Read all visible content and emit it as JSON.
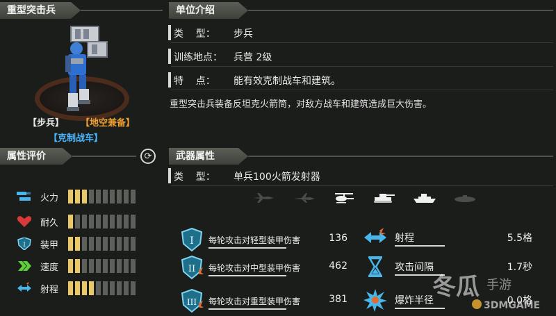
{
  "unit": {
    "name": "重型突击兵",
    "tags": {
      "infantry": "【步兵】",
      "air_ground": "【地空兼备】",
      "counter": "【克制战车】"
    }
  },
  "attributes": {
    "title": "属性评价",
    "items": [
      {
        "label": "火力",
        "icon": "firepower-icon",
        "filled": 3,
        "total": 10
      },
      {
        "label": "耐久",
        "icon": "heart-icon",
        "filled": 1,
        "total": 10
      },
      {
        "label": "装甲",
        "icon": "armor-shield-icon",
        "filled": 2,
        "total": 10
      },
      {
        "label": "速度",
        "icon": "speed-chevrons-icon",
        "filled": 2,
        "total": 10
      },
      {
        "label": "射程",
        "icon": "range-arrows-icon",
        "filled": 4,
        "total": 10
      }
    ]
  },
  "intro": {
    "title": "单位介绍",
    "rows": [
      {
        "key": "类    型：",
        "value": "步兵"
      },
      {
        "key": "训练地点：",
        "value": "兵营 2级"
      },
      {
        "key": "特    点：",
        "value": "能有效克制战车和建筑。"
      }
    ],
    "description": "重型突击兵装备反坦克火箭筒，对敌方战车和建筑造成巨大伤害。"
  },
  "weapon": {
    "title": "武器属性",
    "type_key": "类    型：",
    "type_value": "单兵100火箭发射器",
    "targets": [
      {
        "icon": "jet-fighter-icon",
        "active": false
      },
      {
        "icon": "bomber-plane-icon",
        "active": false
      },
      {
        "icon": "helicopter-icon",
        "active": true
      },
      {
        "icon": "tank-icon",
        "active": true
      },
      {
        "icon": "ship-icon",
        "active": true
      },
      {
        "icon": "submarine-icon",
        "active": false
      }
    ],
    "damage": [
      {
        "label": "每轮攻击对轻型装甲伤害",
        "value": "136",
        "tier": "I"
      },
      {
        "label": "每轮攻击对中型装甲伤害",
        "value": "462",
        "tier": "II"
      },
      {
        "label": "每轮攻击对重型装甲伤害",
        "value": "381",
        "tier": "III"
      }
    ],
    "stats": [
      {
        "label": "射程",
        "value": "5.5格",
        "icon": "range-arrows-icon"
      },
      {
        "label": "攻击间隔",
        "value": "1.7秒",
        "icon": "hourglass-icon"
      },
      {
        "label": "爆炸半径",
        "value": "0.0格",
        "icon": "explosion-icon"
      }
    ]
  },
  "watermark": {
    "text": "冬瓜手游",
    "domain": "3DMGAME"
  },
  "colors": {
    "bar_on": "#e8c868",
    "bar_off": "#5d5f5b",
    "accent_orange": "#f0a030",
    "accent_blue": "#48b6ff"
  }
}
